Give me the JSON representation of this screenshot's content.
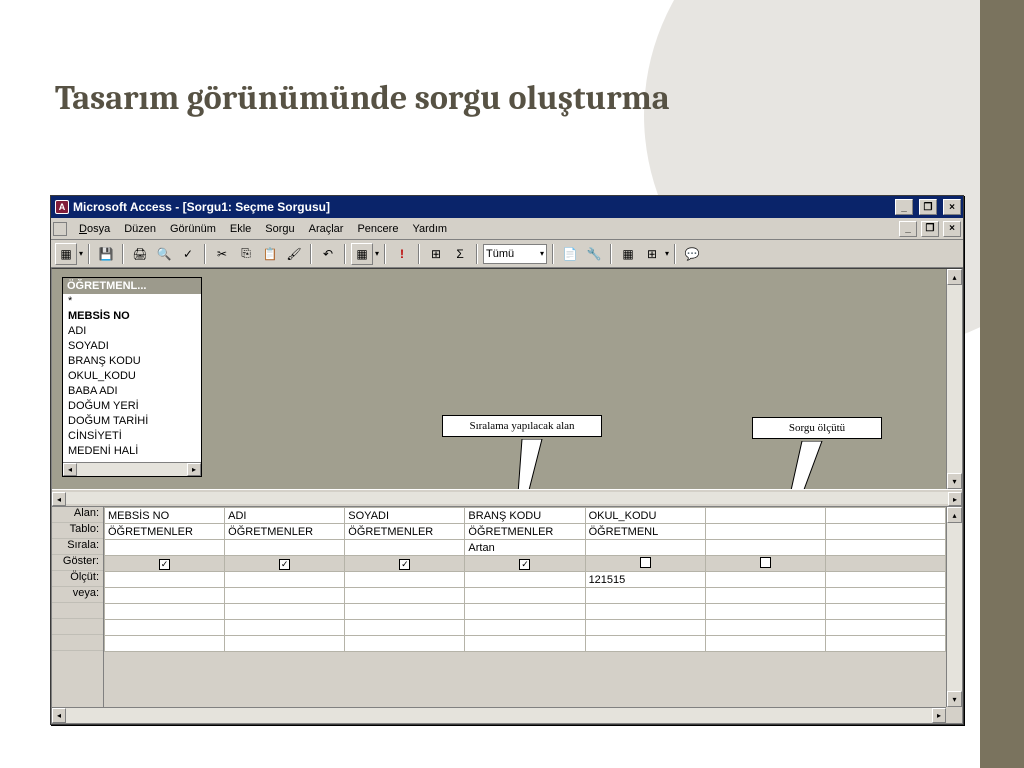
{
  "slide": {
    "title": "Tasarım görünümünde sorgu oluşturma"
  },
  "window": {
    "title": "Microsoft Access - [Sorgu1: Seçme Sorgusu]"
  },
  "menus": {
    "file": "Dosya",
    "edit": "Düzen",
    "view": "Görünüm",
    "insert": "Ekle",
    "query": "Sorgu",
    "tools": "Araçlar",
    "window": "Pencere",
    "help": "Yardım"
  },
  "toolbar": {
    "combo_value": "Tümü"
  },
  "table_box": {
    "title": "ÖĞRETMENL...",
    "fields": [
      "*",
      "MEBSİS NO",
      "ADI",
      "SOYADI",
      "BRANŞ KODU",
      "OKUL_KODU",
      "BABA ADI",
      "DOĞUM YERİ",
      "DOĞUM TARİHİ",
      "CİNSİYETİ",
      "MEDENİ HALİ"
    ]
  },
  "grid_labels": {
    "alan": "Alan:",
    "tablo": "Tablo:",
    "sirala": "Sırala:",
    "goster": "Göster:",
    "olcut": "Ölçüt:",
    "veya": "veya:"
  },
  "columns": [
    {
      "alan": "MEBSİS NO",
      "tablo": "ÖĞRETMENLER",
      "sirala": "",
      "goster": true,
      "olcut": ""
    },
    {
      "alan": "ADI",
      "tablo": "ÖĞRETMENLER",
      "sirala": "",
      "goster": true,
      "olcut": ""
    },
    {
      "alan": "SOYADI",
      "tablo": "ÖĞRETMENLER",
      "sirala": "",
      "goster": true,
      "olcut": ""
    },
    {
      "alan": "BRANŞ KODU",
      "tablo": "ÖĞRETMENLER",
      "sirala": "Artan",
      "goster": true,
      "olcut": ""
    },
    {
      "alan": "OKUL_KODU",
      "tablo": "ÖĞRETMENL",
      "sirala": "",
      "goster": false,
      "olcut": "121515"
    },
    {
      "alan": "",
      "tablo": "",
      "sirala": "",
      "goster": false,
      "olcut": ""
    }
  ],
  "callouts": {
    "sort_field": "Sıralama yapılacak alan",
    "criteria": "Sorgu ölçütü"
  }
}
